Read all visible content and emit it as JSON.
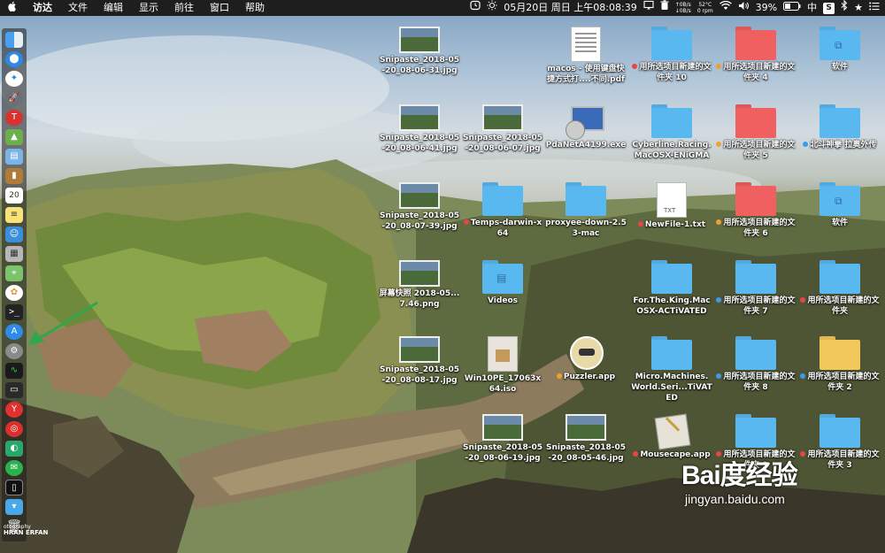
{
  "menubar": {
    "apple_icon": "apple-logo",
    "menus": [
      "访达",
      "文件",
      "编辑",
      "显示",
      "前往",
      "窗口",
      "帮助"
    ],
    "clock": "05月20日 周日 上午08:08:39",
    "net_up": "0B/s",
    "net_down": "0B/s",
    "temp_value": "52°C",
    "temp_label": "0 rpm",
    "battery": "39%",
    "input_method": "中",
    "status_icons": [
      "timer-icon",
      "brightness-icon",
      "display-icon",
      "trash-icon",
      "wifi-icon",
      "bluetooth-icon",
      "spotlight-icon",
      "notification-icon"
    ]
  },
  "dock": {
    "items": [
      "finder",
      "hmm",
      "safari",
      "launchpad",
      "app-red",
      "android",
      "preview",
      "contacts-book",
      "calendar",
      "notes",
      "photo-booth",
      "maps",
      "photos",
      "terminal",
      "app-store",
      "system-preferences",
      "activity-monitor",
      "console",
      "yandex",
      "netease-music",
      "app-green",
      "wechat",
      "iphone",
      "downloads",
      "trash"
    ]
  },
  "photo_credit": {
    "line1": "otography",
    "line2": "HRAN ERFAN"
  },
  "desktop": {
    "items": [
      {
        "label": "Snipaste_2018-05-20_08-06-31.jpg",
        "kind": "screenshot",
        "tag": ""
      },
      {
        "label": "macos - 使用键盘快捷方式打....不同.pdf",
        "kind": "pdf",
        "tag": ""
      },
      {
        "label": "用所选项目新建的文件夹 10",
        "kind": "folder-blue",
        "tag": "red"
      },
      {
        "label": "用所选项目新建的文件夹 4",
        "kind": "folder-red",
        "tag": "orange"
      },
      {
        "label": "软件",
        "kind": "folder-app",
        "tag": ""
      },
      {
        "label": "Snipaste_2018-05-20_08-06-41.jpg",
        "kind": "screenshot",
        "tag": ""
      },
      {
        "label": "Snipaste_2018-05-20_08-06-07.jpg",
        "kind": "screenshot",
        "tag": ""
      },
      {
        "label": "PdaNetA4199.exe",
        "kind": "installer",
        "tag": ""
      },
      {
        "label": "Cyberline.Racing.MacOSX-ENiGMA",
        "kind": "folder-blue",
        "tag": ""
      },
      {
        "label": "用所选项目新建的文件夹 5",
        "kind": "folder-red",
        "tag": "orange"
      },
      {
        "label": "北斗神拳 拉奥外传",
        "kind": "folder-blue",
        "tag": "blue"
      },
      {
        "label": "Snipaste_2018-05-20_08-07-39.jpg",
        "kind": "screenshot",
        "tag": ""
      },
      {
        "label": "Temps-darwin-x64",
        "kind": "folder-blue",
        "tag": "red"
      },
      {
        "label": "proxyee-down-2.53-mac",
        "kind": "folder-blue",
        "tag": ""
      },
      {
        "label": "NewFile-1.txt",
        "kind": "txt",
        "tag": "red"
      },
      {
        "label": "用所选项目新建的文件夹 6",
        "kind": "folder-red",
        "tag": "orange"
      },
      {
        "label": "软件",
        "kind": "folder-app",
        "tag": ""
      },
      {
        "label": "屏幕快照 2018-05...7.46.png",
        "kind": "screenshot",
        "tag": ""
      },
      {
        "label": "Videos",
        "kind": "folder-video",
        "tag": ""
      },
      {
        "label": "For.The.King.MacOSX-ACTiVATED",
        "kind": "folder-blue",
        "tag": ""
      },
      {
        "label": "用所选项目新建的文件夹 7",
        "kind": "folder-blue",
        "tag": "blue"
      },
      {
        "label": "用所选项目新建的文件夹",
        "kind": "folder-blue",
        "tag": "red"
      },
      {
        "label": "Snipaste_2018-05-20_08-08-17.jpg",
        "kind": "screenshot",
        "tag": ""
      },
      {
        "label": "Win10PE_17063x64.iso",
        "kind": "iso",
        "tag": ""
      },
      {
        "label": "Puzzler.app",
        "kind": "app-face",
        "tag": "orange"
      },
      {
        "label": "Micro.Machines.World.Seri...TiVATED",
        "kind": "folder-blue",
        "tag": ""
      },
      {
        "label": "用所选项目新建的文件夹 8",
        "kind": "folder-blue",
        "tag": "blue"
      },
      {
        "label": "用所选项目新建的文件夹 2",
        "kind": "folder-yellow",
        "tag": "blue"
      },
      {
        "label": "Snipaste_2018-05-20_08-06-19.jpg",
        "kind": "screenshot",
        "tag": ""
      },
      {
        "label": "Snipaste_2018-05-20_08-05-46.jpg",
        "kind": "screenshot",
        "tag": ""
      },
      {
        "label": "Mousecape.app",
        "kind": "app-mousecape",
        "tag": "red"
      },
      {
        "label": "用所选项目新建的文件夹 9",
        "kind": "folder-blue",
        "tag": "red"
      },
      {
        "label": "用所选项目新建的文件夹 3",
        "kind": "folder-blue",
        "tag": "red"
      }
    ]
  },
  "watermark": {
    "logo": "Bai度经验",
    "url": "jingyan.baidu.com"
  },
  "colors": {
    "tag_red": "#e64545",
    "tag_orange": "#f0a030",
    "tag_blue": "#3f9ae8",
    "folder_blue": "#5ab8f0",
    "folder_red": "#f06060",
    "folder_yellow": "#f2c85a",
    "arrow_green": "#2ea84a"
  }
}
